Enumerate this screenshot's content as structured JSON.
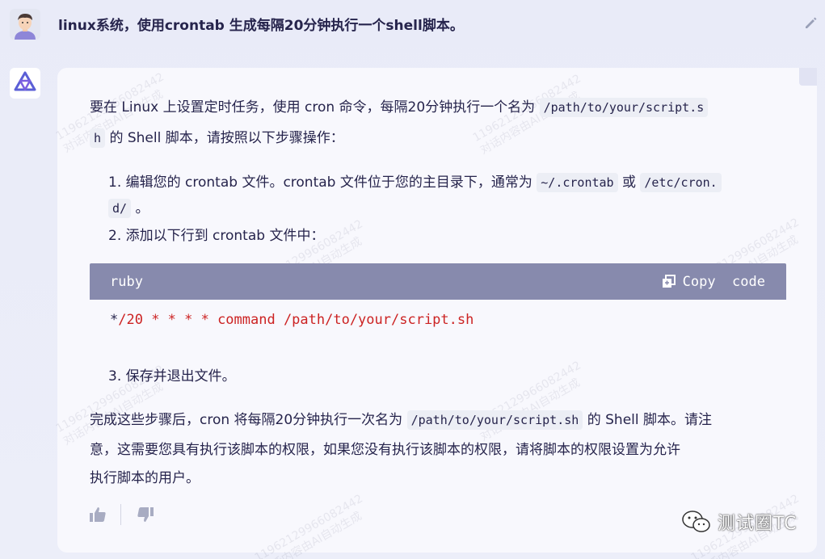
{
  "user": {
    "message": "linux系统，使用crontab 生成每隔20分钟执行一个shell脚本。"
  },
  "answer": {
    "intro_a": "要在 Linux 上设置定时任务，使用 cron 命令，每隔20分钟执行一个名为",
    "intro_code_a": "/path/to/your/script.s",
    "intro_code_b": "h",
    "intro_b": "的 Shell 脚本，请按照以下步骤操作：",
    "step1_a": "1. 编辑您的 crontab 文件。crontab 文件位于您的主目录下，通常为",
    "step1_code1": "~/.crontab",
    "step1_or": "或",
    "step1_code2a": "/etc/cron.",
    "step1_code2b": "d/",
    "step1_end": "。",
    "step2": "2. 添加以下行到 crontab 文件中：",
    "code": {
      "language": "ruby",
      "copy_label": "Copy  code",
      "line_prefix": "*",
      "line_rest": "/20 * * * * command /path/to/your/script.sh"
    },
    "step3": "3. 保存并退出文件。",
    "outro_a": "完成这些步骤后，cron 将每隔20分钟执行一次名为",
    "outro_code": "/path/to/your/script.sh",
    "outro_b": "的 Shell 脚本。请注",
    "outro_line2": "意，这需要您具有执行该脚本的权限，如果您没有执行该脚本的权限，请将脚本的权限设置为允许",
    "outro_line3": "执行脚本的用户。"
  },
  "watermark": {
    "id": "11962129966082442",
    "text": "对话内容由AI自动生成"
  },
  "brand": {
    "label": "测试圈TC"
  },
  "icons": [
    "user-avatar",
    "edit-icon",
    "bot-logo-icon",
    "copy-icon",
    "thumbs-up-icon",
    "thumbs-down-icon",
    "wechat-icon"
  ],
  "colors": {
    "code_header": "#878aad",
    "code_text": "#cc2323",
    "text": "#26244c",
    "card": "#f8f8fd"
  }
}
